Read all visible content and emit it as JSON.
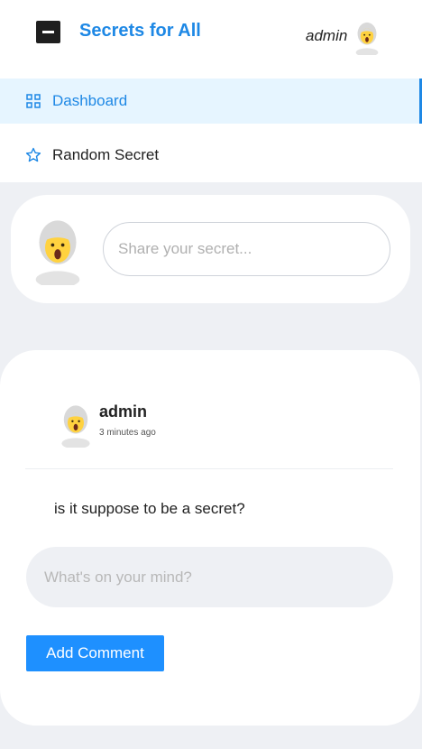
{
  "header": {
    "app_title": "Secrets for All",
    "user_name": "admin"
  },
  "nav": {
    "items": [
      {
        "label": "Dashboard",
        "icon": "grid-icon",
        "active": true
      },
      {
        "label": "Random Secret",
        "icon": "star-icon",
        "active": false
      }
    ]
  },
  "share": {
    "placeholder": "Share your secret..."
  },
  "post": {
    "author": "admin",
    "time": "3 minutes ago",
    "body": "is it suppose to be a secret?",
    "comment_placeholder": "What's on your mind?",
    "add_comment_label": "Add Comment"
  },
  "colors": {
    "accent": "#1e88e5",
    "button": "#1e90ff",
    "background": "#eef0f4",
    "nav_active_bg": "#e6f5ff"
  }
}
